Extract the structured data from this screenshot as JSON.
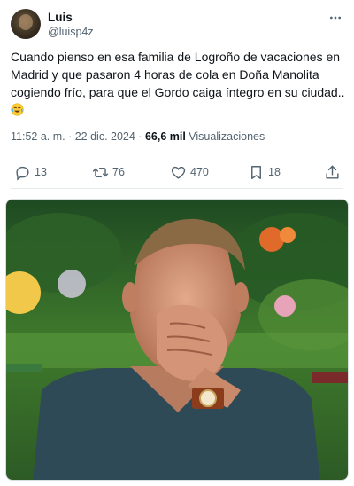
{
  "author": {
    "name": "Luis",
    "handle": "@luisp4z"
  },
  "tweet": {
    "text": "Cuando pienso en esa familia de Logroño de vacaciones en Madrid y que pasaron 4 horas de cola en Doña Manolita cogiendo frío, para que el Gordo caiga íntegro en su ciudad..",
    "emoji": "face-with-tears-of-joy-icon"
  },
  "meta": {
    "time": "11:52 a. m.",
    "separator1": " · ",
    "date": "22 dic. 2024",
    "separator2": " · ",
    "views_count": "66,6 mil",
    "views_label": "Visualizaciones"
  },
  "actions": {
    "replies": "13",
    "reposts": "76",
    "likes": "470",
    "bookmarks": "18"
  },
  "media": {
    "description": "photo-meme"
  },
  "colors": {
    "text": "#0f1419",
    "secondary": "#536471",
    "divider": "#e4e9ec"
  }
}
